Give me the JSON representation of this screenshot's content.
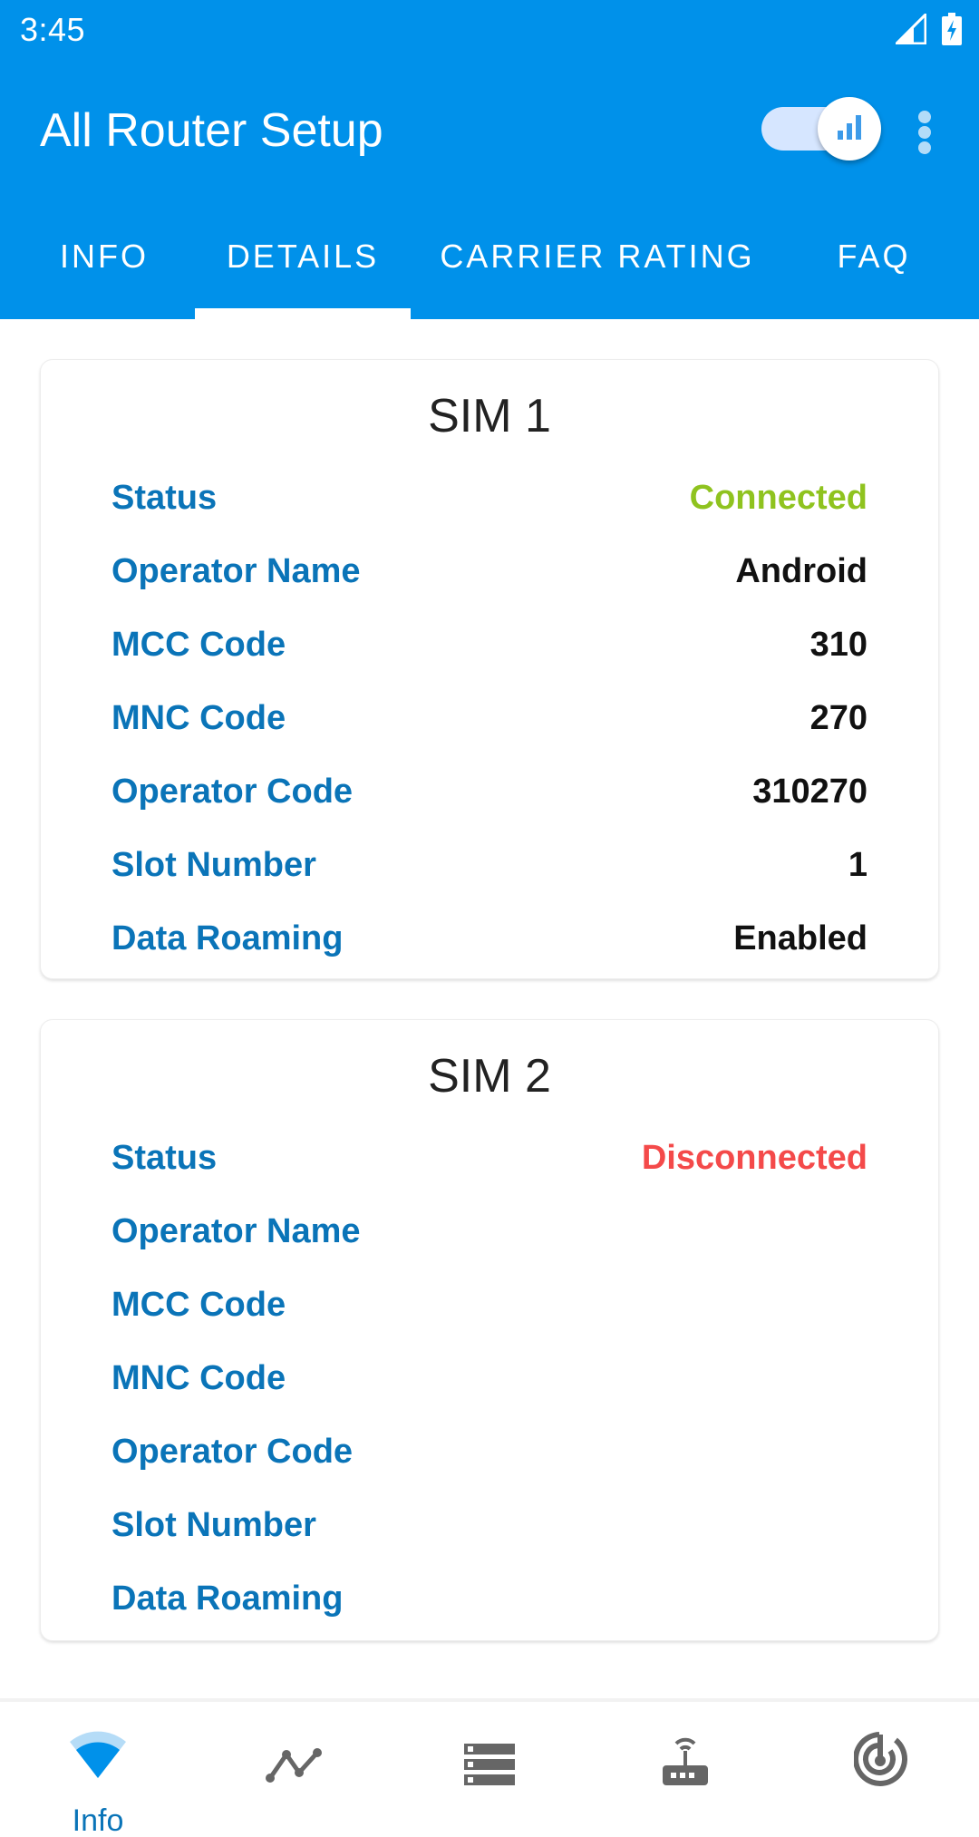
{
  "status_bar": {
    "time": "3:45",
    "icons": [
      "cell-signal-icon",
      "battery-charging-icon"
    ]
  },
  "app_bar": {
    "title": "All Router Setup",
    "toggle": {
      "state": "on",
      "icon": "signal-bars-icon"
    },
    "overflow_icon": "more-vert-icon"
  },
  "tabs": {
    "items": [
      {
        "label": "INFO"
      },
      {
        "label": "DETAILS"
      },
      {
        "label": "CARRIER RATING"
      },
      {
        "label": "FAQ"
      }
    ],
    "selected": "DETAILS"
  },
  "sims": [
    {
      "title": "SIM 1",
      "rows": [
        {
          "label": "Status",
          "value": "Connected",
          "color": "#8fc31f"
        },
        {
          "label": "Operator Name",
          "value": "Android"
        },
        {
          "label": "MCC Code",
          "value": "310"
        },
        {
          "label": "MNC Code",
          "value": "270"
        },
        {
          "label": "Operator Code",
          "value": "310270"
        },
        {
          "label": "Slot Number",
          "value": "1"
        },
        {
          "label": "Data Roaming",
          "value": "Enabled"
        }
      ]
    },
    {
      "title": "SIM 2",
      "rows": [
        {
          "label": "Status",
          "value": "Disconnected",
          "color": "#f44a4a"
        },
        {
          "label": "Operator Name",
          "value": ""
        },
        {
          "label": "MCC Code",
          "value": ""
        },
        {
          "label": "MNC Code",
          "value": ""
        },
        {
          "label": "Operator Code",
          "value": ""
        },
        {
          "label": "Slot Number",
          "value": ""
        },
        {
          "label": "Data Roaming",
          "value": ""
        }
      ]
    }
  ],
  "bottom_nav": {
    "items": [
      {
        "icon": "wifi-icon",
        "label": "Info",
        "active": true
      },
      {
        "icon": "chart-line-icon",
        "label": ""
      },
      {
        "icon": "server-list-icon",
        "label": ""
      },
      {
        "icon": "router-icon",
        "label": ""
      },
      {
        "icon": "radar-icon",
        "label": ""
      }
    ]
  },
  "colors": {
    "primary": "#0091ea",
    "label_blue": "#0a74b8",
    "connected": "#8fc31f",
    "disconnected": "#f44a4a",
    "icon_gray": "#666666"
  }
}
